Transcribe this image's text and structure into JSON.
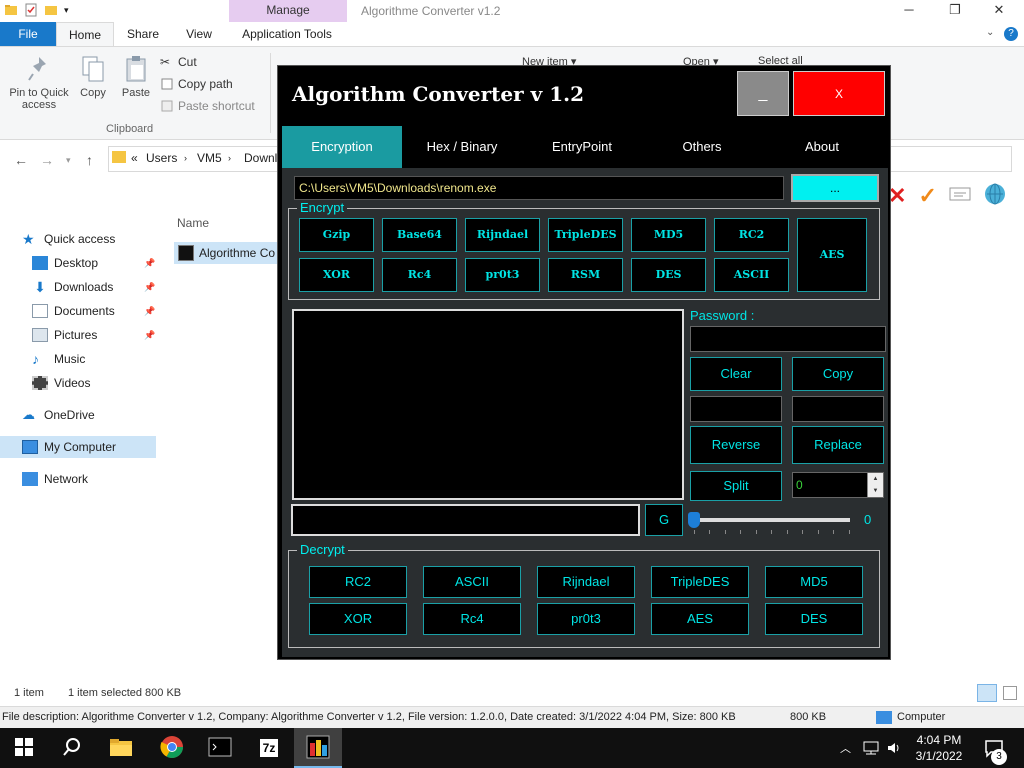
{
  "explorer": {
    "title": "Algorithme Converter v1.2",
    "manage_tab": "Manage",
    "tabs": {
      "file": "File",
      "home": "Home",
      "share": "Share",
      "view": "View",
      "app_tools": "Application Tools"
    },
    "ribbon": {
      "pin": "Pin to Quick access",
      "copy": "Copy",
      "paste": "Paste",
      "cut": "Cut",
      "copy_path": "Copy path",
      "paste_shortcut": "Paste shortcut",
      "clipboard": "Clipboard",
      "new_item": "New item",
      "open": "Open",
      "select_all": "Select all"
    },
    "address": {
      "chevron": "«",
      "crumbs": [
        "Users",
        "VM5",
        "Downl"
      ]
    },
    "nav": {
      "quick_access": "Quick access",
      "desktop": "Desktop",
      "downloads": "Downloads",
      "documents": "Documents",
      "pictures": "Pictures",
      "music": "Music",
      "videos": "Videos",
      "onedrive": "OneDrive",
      "my_computer": "My Computer",
      "network": "Network"
    },
    "column_name": "Name",
    "file_name": "Algorithme Co",
    "status": {
      "items": "1 item",
      "selected": "1 item selected  800 KB"
    },
    "details": {
      "description": "File description: Algorithme Converter v 1.2, Company: Algorithme Converter v 1.2, File version: 1.2.0.0, Date created: 3/1/2022 4:04 PM, Size: 800 KB",
      "size": "800 KB",
      "computer": "Computer"
    }
  },
  "taskbar": {
    "time": "4:04 PM",
    "date": "3/1/2022",
    "notifications": "3"
  },
  "app": {
    "title": "Algorithm Converter v 1.2",
    "minimize": "_",
    "close": "X",
    "tabs": [
      "Encryption",
      "Hex / Binary",
      "EntryPoint",
      "Others",
      "About"
    ],
    "path": "C:\\Users\\VM5\\Downloads\\renom.exe",
    "browse": "...",
    "encrypt": {
      "label": "Encrypt",
      "row1": [
        "Gzip",
        "Base64",
        "Rijndael",
        "TripleDES",
        "MD5",
        "RC2"
      ],
      "row2": [
        "XOR",
        "Rc4",
        "pr0t3",
        "RSM",
        "DES",
        "ASCII"
      ],
      "aes": "AES"
    },
    "password_label": "Password :",
    "buttons": {
      "clear": "Clear",
      "copy": "Copy",
      "reverse": "Reverse",
      "replace": "Replace",
      "split": "Split",
      "g": "G"
    },
    "spinner_value": "0",
    "slider_value": "0",
    "decrypt": {
      "label": "Decrypt",
      "row1": [
        "RC2",
        "ASCII",
        "Rijndael",
        "TripleDES",
        "MD5"
      ],
      "row2": [
        "XOR",
        "Rc4",
        "pr0t3",
        "AES",
        "DES"
      ]
    }
  }
}
